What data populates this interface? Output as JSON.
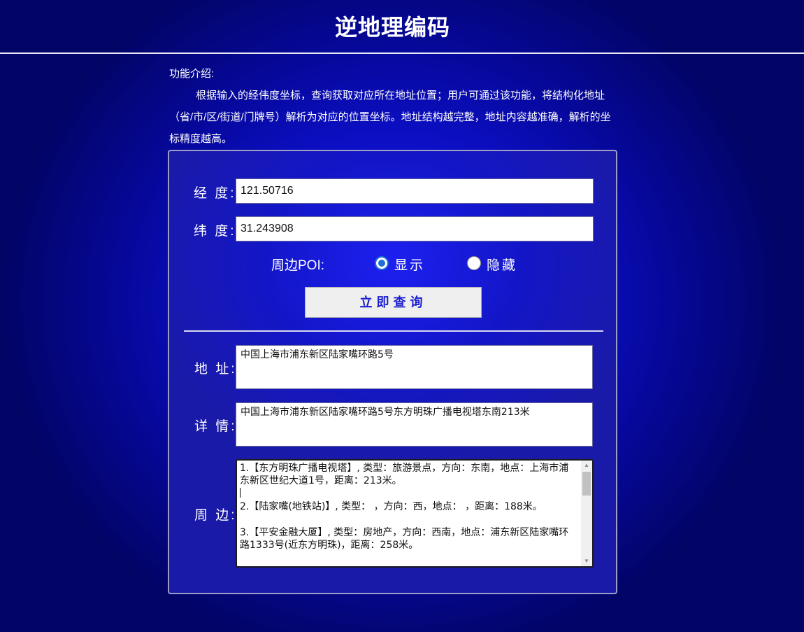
{
  "header": {
    "title": "逆地理编码"
  },
  "intro": {
    "heading": "功能介绍:",
    "body": "根据输入的经伟度坐标，查询获取对应所在地址位置；用户可通过该功能，将结构化地址（省/市/区/街道/门牌号）解析为对应的位置坐标。地址结构越完整，地址内容越准确，解析的坐标精度越高。"
  },
  "form": {
    "longitude_label": "经 度:",
    "longitude_value": "121.50716",
    "latitude_label": "纬 度:",
    "latitude_value": "31.243908",
    "poi_label": "周边POI:",
    "poi_show_label": "显示",
    "poi_hide_label": "隐藏",
    "poi_selected": "显示",
    "query_button": "立即查询"
  },
  "result": {
    "address_label": "地 址:",
    "address_value": "中国上海市浦东新区陆家嘴环路5号",
    "detail_label": "详 情:",
    "detail_value": "中国上海市浦东新区陆家嘴环路5号东方明珠广播电视塔东南213米",
    "nearby_label": "周 边:",
    "nearby_items": [
      "1.【东方明珠广播电视塔】, 类型：旅游景点，方向：东南，地点：上海市浦东新区世纪大道1号，距离：213米。",
      "2.【陆家嘴(地铁站)】, 类型： ，方向：西，地点： ，距离：188米。",
      "3.【平安金融大厦】, 类型：房地产，方向：西南，地点：浦东新区陆家嘴环路1333号(近东方明珠)，距离：258米。"
    ]
  },
  "colors": {
    "background": "#0c0fc4",
    "button_text": "#1a1fd0",
    "radio_accent": "#1f6fd6"
  }
}
